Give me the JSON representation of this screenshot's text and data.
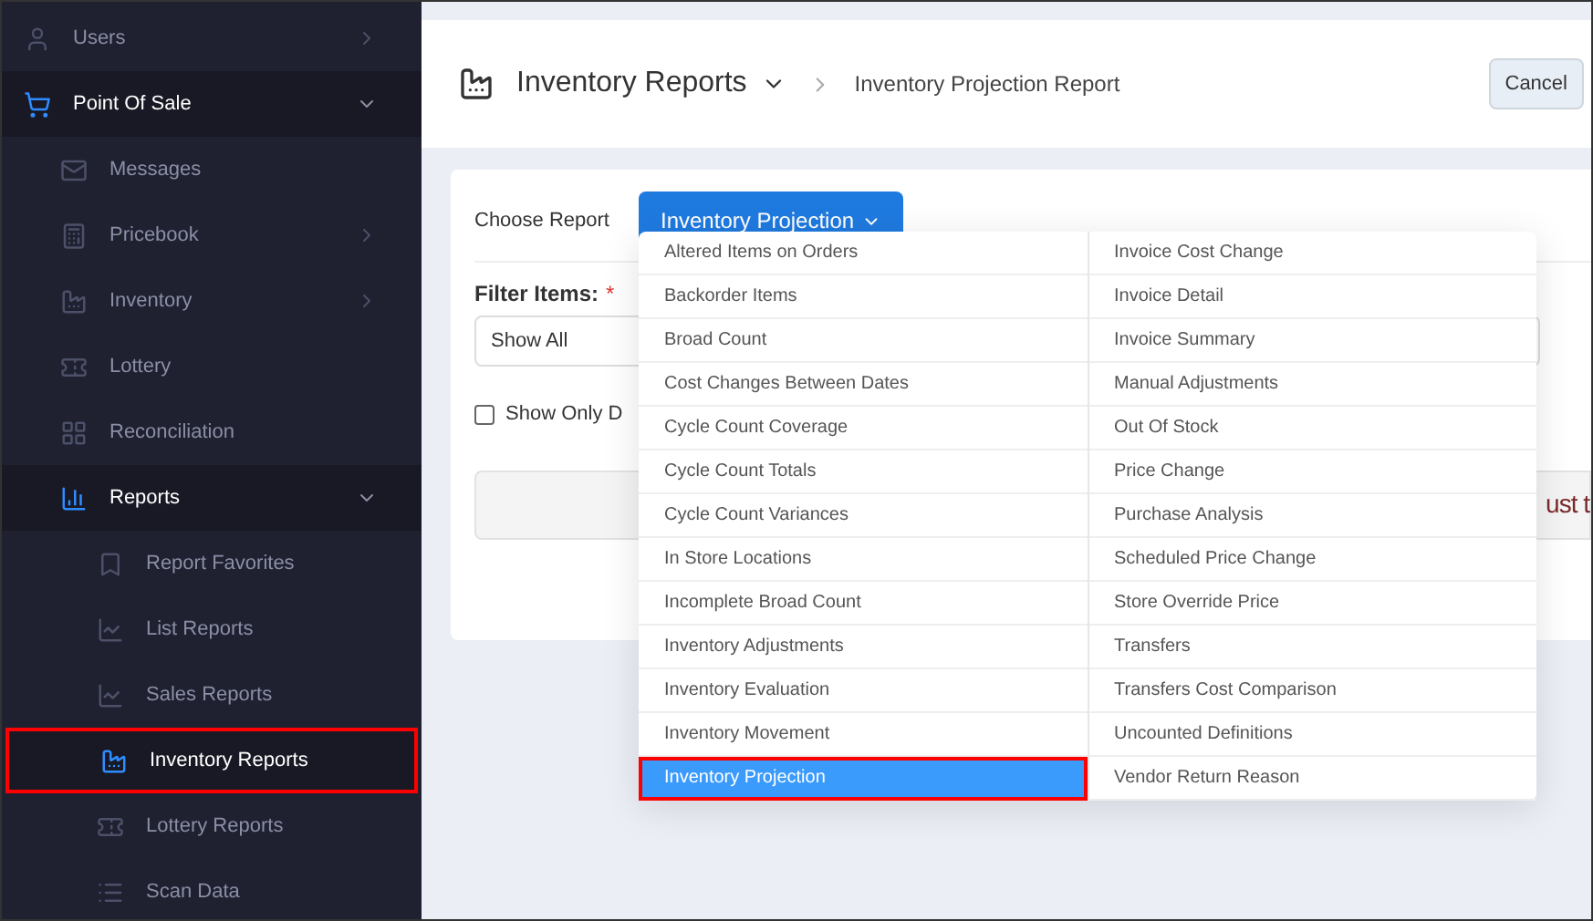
{
  "sidebar": {
    "items": [
      {
        "label": "Users",
        "expanded": false,
        "selected": false
      },
      {
        "label": "Point Of Sale",
        "expanded": true,
        "selected": false,
        "children": [
          {
            "label": "Messages",
            "selected": false
          },
          {
            "label": "Pricebook",
            "expanded": false,
            "selected": false
          },
          {
            "label": "Inventory",
            "expanded": false,
            "selected": false
          },
          {
            "label": "Lottery",
            "selected": false
          },
          {
            "label": "Reconciliation",
            "selected": false
          },
          {
            "label": "Reports",
            "expanded": true,
            "selected": false,
            "children": [
              {
                "label": "Report Favorites",
                "selected": false
              },
              {
                "label": "List Reports",
                "selected": false
              },
              {
                "label": "Sales Reports",
                "selected": false
              },
              {
                "label": "Inventory Reports",
                "selected": true
              },
              {
                "label": "Lottery Reports",
                "selected": false
              },
              {
                "label": "Scan Data",
                "selected": false
              }
            ]
          }
        ]
      }
    ]
  },
  "header": {
    "title": "Inventory Reports",
    "breadcrumb": "Inventory Projection Report",
    "cancel_button": "Cancel"
  },
  "report_form": {
    "choose_label": "Choose Report",
    "report_button": "Inventory Projection",
    "menu_open": true,
    "menu_items": [
      {
        "label": "Altered Items on Orders",
        "selected": false
      },
      {
        "label": "Backorder Items",
        "selected": false
      },
      {
        "label": "Broad Count",
        "selected": false
      },
      {
        "label": "Cost Changes Between Dates",
        "selected": false
      },
      {
        "label": "Cycle Count Coverage",
        "selected": false
      },
      {
        "label": "Cycle Count Totals",
        "selected": false
      },
      {
        "label": "Cycle Count Variances",
        "selected": false
      },
      {
        "label": "In Store Locations",
        "selected": false
      },
      {
        "label": "Incomplete Broad Count",
        "selected": false
      },
      {
        "label": "Inventory Adjustments",
        "selected": false
      },
      {
        "label": "Inventory Evaluation",
        "selected": false
      },
      {
        "label": "Inventory Movement",
        "selected": false
      },
      {
        "label": "Inventory Projection",
        "selected": true
      },
      {
        "label": "Invoice Cost Change",
        "selected": false
      },
      {
        "label": "Invoice Detail",
        "selected": false
      },
      {
        "label": "Invoice Summary",
        "selected": false
      },
      {
        "label": "Manual Adjustments",
        "selected": false
      },
      {
        "label": "Out Of Stock",
        "selected": false
      },
      {
        "label": "Price Change",
        "selected": false
      },
      {
        "label": "Purchase Analysis",
        "selected": false
      },
      {
        "label": "Scheduled Price Change",
        "selected": false
      },
      {
        "label": "Store Override Price",
        "selected": false
      },
      {
        "label": "Transfers",
        "selected": false
      },
      {
        "label": "Transfers Cost Comparison",
        "selected": false
      },
      {
        "label": "Uncounted Definitions",
        "selected": false
      },
      {
        "label": "Vendor Return Reason",
        "selected": false
      }
    ],
    "filter_label": "Filter Items:",
    "required_mark": "*",
    "filter_value": "Show All",
    "checkbox": {
      "label": "Show Only D",
      "checked": false
    },
    "notice": "ust t"
  }
}
